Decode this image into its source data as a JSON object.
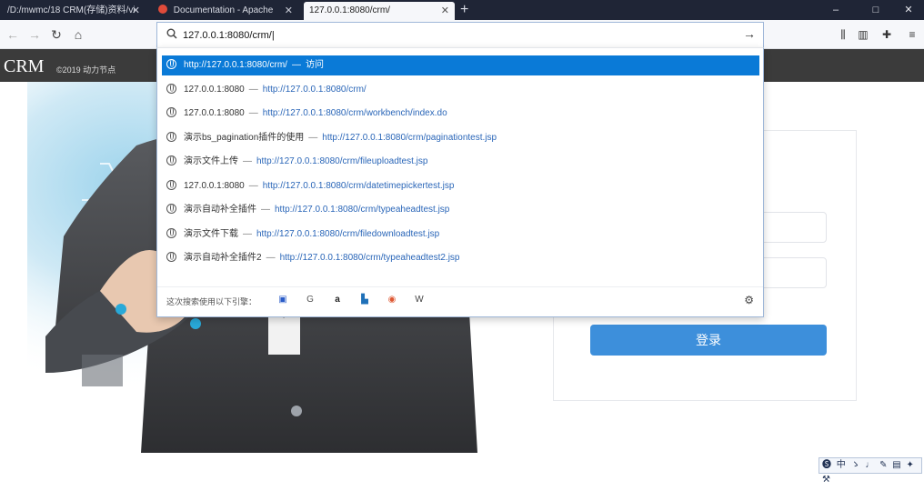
{
  "tabs": [
    {
      "title": "/D:/mwmc/18 CRM(存储)资料/vi"
    },
    {
      "title": "Documentation - Apache"
    },
    {
      "title": "127.0.0.1:8080/crm/"
    }
  ],
  "window_controls": {
    "minimize": "–",
    "maximize": "□",
    "close": "✕"
  },
  "nav": {
    "back": "←",
    "forward": "→",
    "reload": "↻",
    "home": "⌂"
  },
  "urlbar": {
    "value": "127.0.0.1:8080/crm/|",
    "go": "→"
  },
  "suggestions": [
    {
      "title": "http://127.0.0.1:8080/crm/",
      "sep": "—",
      "url": "访问",
      "selected": true
    },
    {
      "title": "127.0.0.1:8080",
      "sep": "—",
      "url": "http://127.0.0.1:8080/crm/",
      "selected": false
    },
    {
      "title": "127.0.0.1:8080",
      "sep": "—",
      "url": "http://127.0.0.1:8080/crm/workbench/index.do",
      "selected": false
    },
    {
      "title": "演示bs_pagination插件的使用",
      "sep": "—",
      "url": "http://127.0.0.1:8080/crm/paginationtest.jsp",
      "selected": false
    },
    {
      "title": "演示文件上传",
      "sep": "—",
      "url": "http://127.0.0.1:8080/crm/fileuploadtest.jsp",
      "selected": false
    },
    {
      "title": "127.0.0.1:8080",
      "sep": "—",
      "url": "http://127.0.0.1:8080/crm/datetimepickertest.jsp",
      "selected": false
    },
    {
      "title": "演示自动补全插件",
      "sep": "—",
      "url": "http://127.0.0.1:8080/crm/typeaheadtest.jsp",
      "selected": false
    },
    {
      "title": "演示文件下载",
      "sep": "—",
      "url": "http://127.0.0.1:8080/crm/filedownloadtest.jsp",
      "selected": false
    },
    {
      "title": "演示自动补全插件2",
      "sep": "—",
      "url": "http://127.0.0.1:8080/crm/typeaheadtest2.jsp",
      "selected": false
    }
  ],
  "search_engines": {
    "label": "这次搜索使用以下引擎：",
    "engines": [
      "baidu-icon",
      "google-icon",
      "amazon-icon",
      "bing-icon",
      "duckduckgo-icon",
      "wikipedia-icon"
    ]
  },
  "page": {
    "brand": "CRM",
    "brand_subtitle": "©2019 动力节点",
    "login_button": "登录"
  },
  "ime": {
    "lang": "中",
    "items": [
      "ゝ",
      "♩",
      "✎",
      "▤",
      "✦",
      "⚒"
    ]
  },
  "colors": {
    "selection": "#0a7ad7",
    "login_button": "#3d8fdb",
    "header": "#3b3b3b",
    "tabbar": "#1f2536"
  }
}
